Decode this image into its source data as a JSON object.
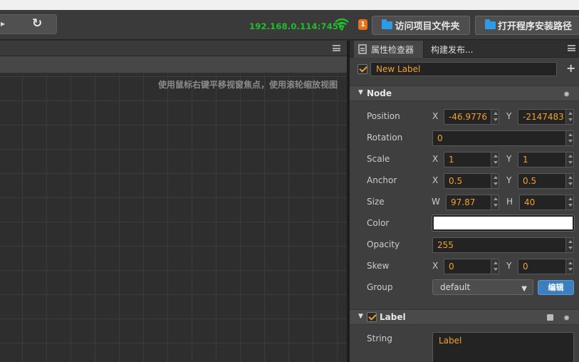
{
  "toolbar": {
    "ip_address": "192.168.0.114:7456",
    "notification_count": "1",
    "open_project_folder": "访问项目文件夹",
    "open_install_path": "打开程序安装路径"
  },
  "scene": {
    "hint": "使用鼠标右键平移视窗焦点，使用滚轮缩放视图"
  },
  "inspector": {
    "tabs": [
      "属性检查器",
      "构建发布..."
    ],
    "node_name": "New Label",
    "node_section": "Node",
    "properties": {
      "position": {
        "label": "Position",
        "x_label": "X",
        "x": "-46.9776",
        "y_label": "Y",
        "y": "-2147483"
      },
      "rotation": {
        "label": "Rotation",
        "value": "0"
      },
      "scale": {
        "label": "Scale",
        "x_label": "X",
        "x": "1",
        "y_label": "Y",
        "y": "1"
      },
      "anchor": {
        "label": "Anchor",
        "x_label": "X",
        "x": "0.5",
        "y_label": "Y",
        "y": "0.5"
      },
      "size": {
        "label": "Size",
        "w_label": "W",
        "w": "97.87",
        "h_label": "H",
        "h": "40"
      },
      "color": {
        "label": "Color",
        "value": "#ffffff"
      },
      "opacity": {
        "label": "Opacity",
        "value": "255"
      },
      "skew": {
        "label": "Skew",
        "x_label": "X",
        "x": "0",
        "y_label": "Y",
        "y": "0"
      },
      "group": {
        "label": "Group",
        "value": "default",
        "edit_label": "编辑"
      }
    },
    "label_section": "Label",
    "string": {
      "label": "String",
      "value": "Label"
    }
  },
  "colors": {
    "accent_orange": "#f0a030",
    "ip_green": "#1fbf2a",
    "edit_blue": "#3d7fbe",
    "folder_blue": "#2f9be6"
  }
}
